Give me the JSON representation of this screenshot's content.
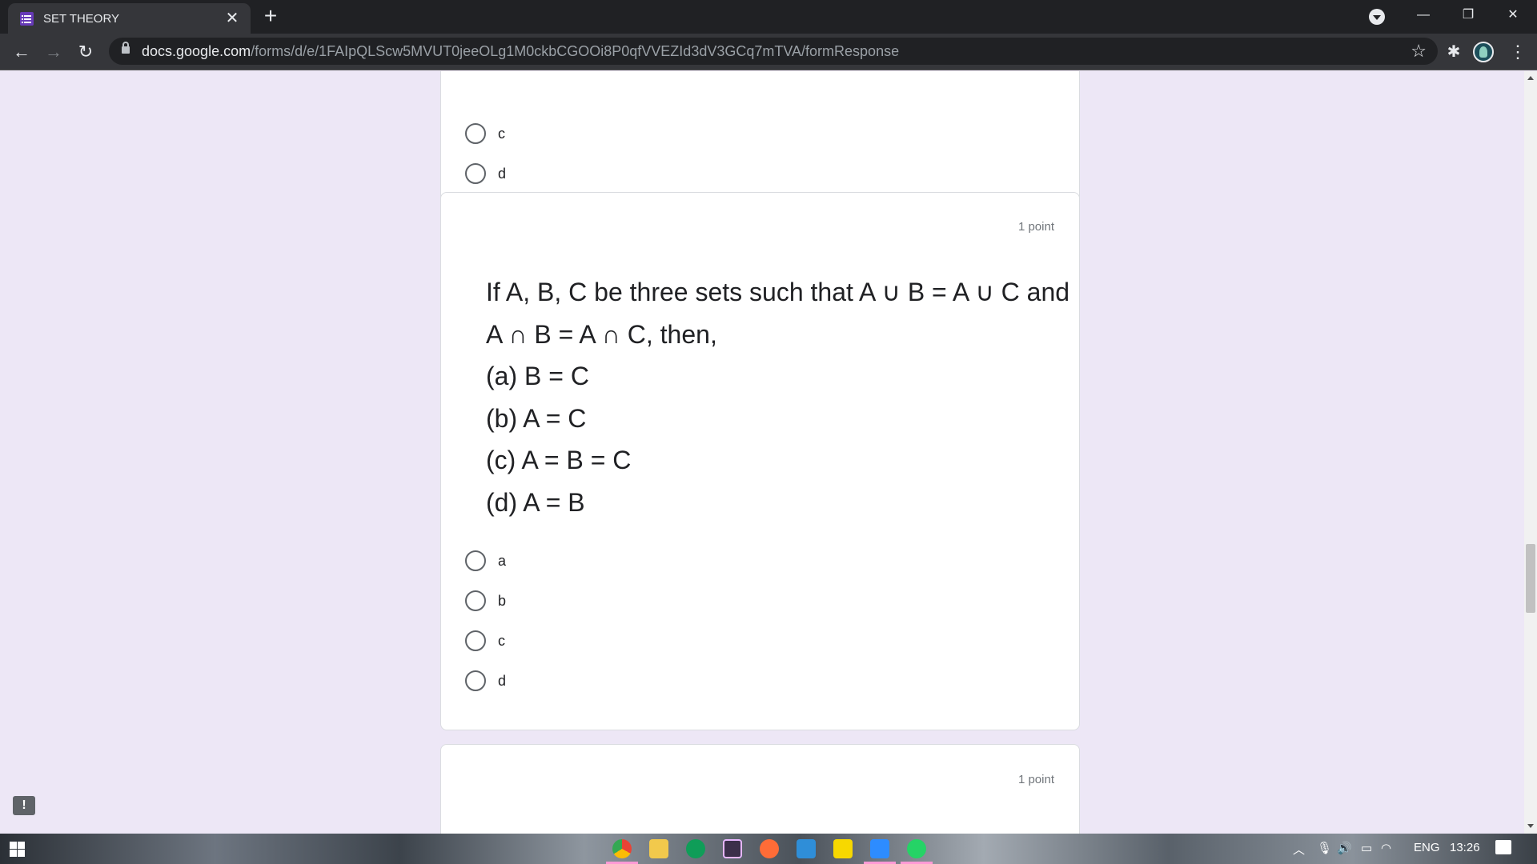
{
  "browser": {
    "tab_title": "SET THEORY",
    "tab_close": "✕",
    "new_tab": "+",
    "url_host": "docs.google.com",
    "url_path": "/forms/d/e/1FAIpQLScw5MVUT0jeeOLg1M0ckbCGOOi8P0qfVVEZId3dV3GCq7mTVA/formResponse",
    "back": "←",
    "forward": "→",
    "reload": "↻",
    "star": "☆",
    "extensions": "✱",
    "menu": "⋮",
    "minimize": "—",
    "restore": "❐",
    "close": "✕"
  },
  "form": {
    "prev_question": {
      "options": [
        "c",
        "d"
      ]
    },
    "question": {
      "points": "1 point",
      "text_lines": [
        "If A, B, C be three sets such that A ∪ B = A ∪ C and",
        "A ∩ B = A ∩ C, then,",
        "(a) B = C",
        "(b) A = C",
        "(c) A = B = C",
        "(d) A = B"
      ],
      "options": [
        "a",
        "b",
        "c",
        "d"
      ]
    },
    "next_question": {
      "points": "1 point",
      "partial_text": "(      )   (    )"
    },
    "report_icon": "!"
  },
  "taskbar": {
    "language": "ENG",
    "time": "13:26",
    "apps": [
      "chrome",
      "file-explorer",
      "app-green",
      "terminal",
      "postman",
      "vscode",
      "sticky-notes",
      "zoom",
      "whatsapp"
    ]
  },
  "colors": {
    "page_bg": "#ede7f6",
    "form_accent": "#673ab7",
    "card_bg": "#ffffff",
    "chrome_dark": "#202124"
  }
}
